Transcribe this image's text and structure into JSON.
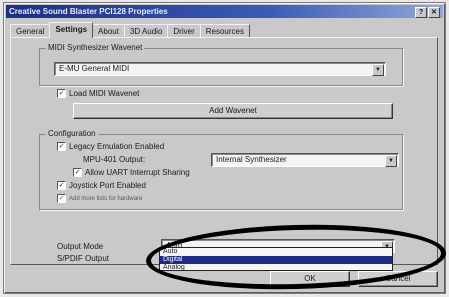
{
  "window": {
    "title": "Creative Sound Blaster PCI128 Properties",
    "help_icon": "?",
    "close_icon": "✕"
  },
  "tabs": [
    "General",
    "Settings",
    "About",
    "3D Audio",
    "Driver",
    "Resources"
  ],
  "midi": {
    "group_label": "MIDI Synthesizer Wavenet",
    "synth_value": "E-MU General MIDI",
    "load_checkbox": "Load MIDI Wavenet",
    "add_button": "Add Wavenet"
  },
  "configuration": {
    "group_label": "Configuration",
    "legacy_checkbox": "Legacy Emulation Enabled",
    "mpu_label": "MPU-401 Output:",
    "mpu_value": "Internal Synthesizer",
    "uart_checkbox": "Allow UART Interrupt Sharing",
    "joystick_checkbox": "Joystick Port Enabled",
    "extra_checkbox": "Add more lists for hardware"
  },
  "output": {
    "mode_label": "Output Mode",
    "mode_value": "Auto",
    "spdif_label": "S/PDIF Output",
    "dropdown_items": [
      "Auto",
      "Digital",
      "Analog"
    ]
  },
  "buttons": {
    "ok": "OK",
    "cancel": "Cancel"
  }
}
